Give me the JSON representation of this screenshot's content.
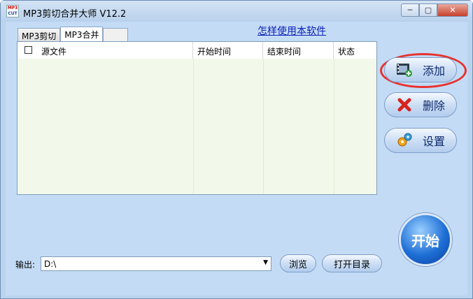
{
  "window": {
    "title": "MP3剪切合并大师 V12.2",
    "icon_top": "MP3",
    "icon_bottom": "CUT",
    "minimize_glyph": "─",
    "maximize_glyph": "▢",
    "close_glyph": "✕"
  },
  "tabs": [
    {
      "label": "MP3剪切",
      "active": false
    },
    {
      "label": "MP3合并",
      "active": true
    }
  ],
  "help_link": "怎样使用本软件",
  "list": {
    "columns": [
      "源文件",
      "开始时间",
      "结束时间",
      "状态"
    ],
    "rows": []
  },
  "buttons": {
    "add": {
      "label": "添加",
      "icon": "film-add-icon"
    },
    "delete": {
      "label": "删除",
      "icon": "red-x-icon"
    },
    "settings": {
      "label": "设置",
      "icon": "gears-icon"
    },
    "start": {
      "label": "开始"
    },
    "browse": {
      "label": "浏览"
    },
    "open_dir": {
      "label": "打开目录"
    }
  },
  "output": {
    "label": "输出:",
    "value": "D:\\"
  },
  "colors": {
    "highlight_ring": "#e8322e",
    "link": "#0a1fb8",
    "list_background": "#f3f9ea"
  }
}
